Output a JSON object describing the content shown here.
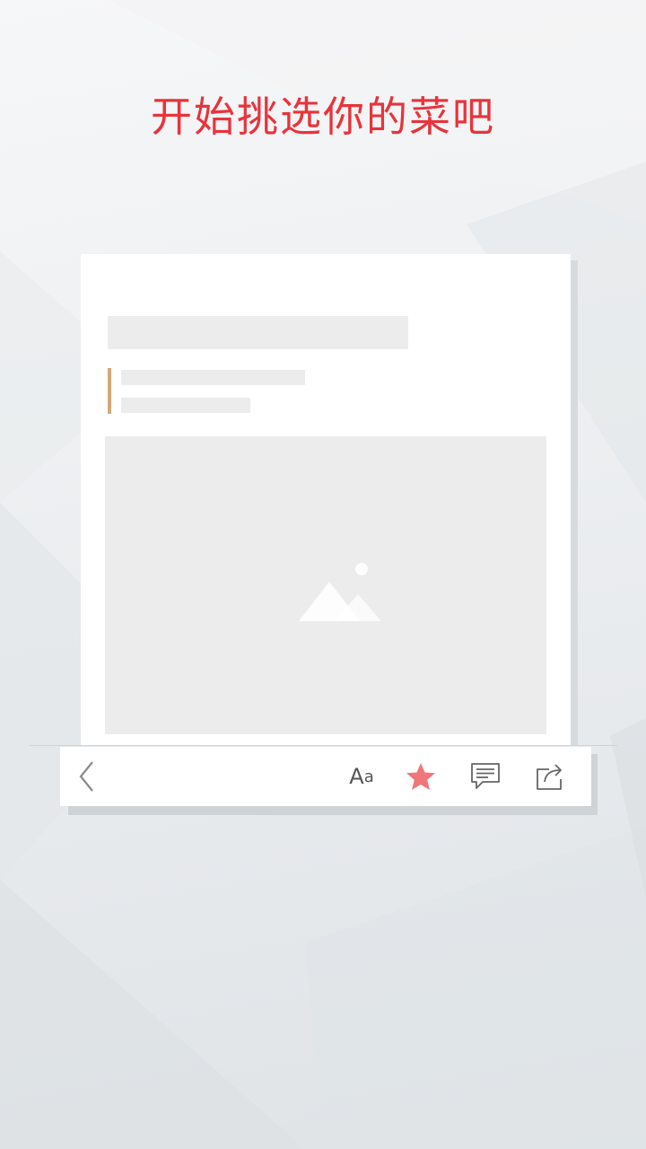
{
  "headline": "开始挑选你的菜吧",
  "toolbar": {
    "font_glyph_big": "A",
    "font_glyph_small": "a",
    "favorite_color": "#f0767a"
  },
  "colors": {
    "headline": "#e8333b",
    "accent": "#d4a878",
    "placeholder": "#ececec"
  }
}
